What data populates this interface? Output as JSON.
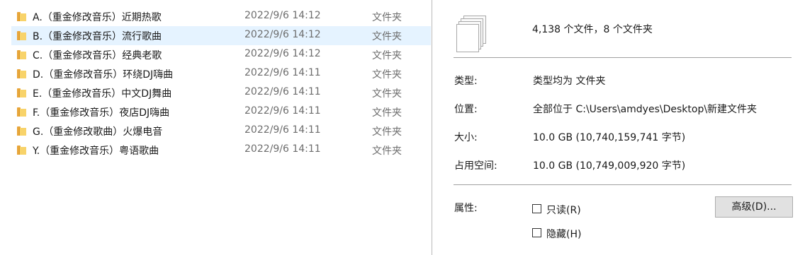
{
  "file_list": {
    "rows": [
      {
        "name": "A.（重金修改音乐）近期热歌",
        "date": "2022/9/6 14:12",
        "type": "文件夹"
      },
      {
        "name": "B.（重金修改音乐）流行歌曲",
        "date": "2022/9/6 14:12",
        "type": "文件夹"
      },
      {
        "name": "C.（重金修改音乐）经典老歌",
        "date": "2022/9/6 14:12",
        "type": "文件夹"
      },
      {
        "name": "D.（重金修改音乐）环绕DJ嗨曲",
        "date": "2022/9/6 14:11",
        "type": "文件夹"
      },
      {
        "name": "E.（重金修改音乐）中文DJ舞曲",
        "date": "2022/9/6 14:11",
        "type": "文件夹"
      },
      {
        "name": "F.（重金修改音乐）夜店DJ嗨曲",
        "date": "2022/9/6 14:11",
        "type": "文件夹"
      },
      {
        "name": "G.（重金修改歌曲）火爆电音",
        "date": "2022/9/6 14:11",
        "type": "文件夹"
      },
      {
        "name": "Y.（重金修改音乐）粤语歌曲",
        "date": "2022/9/6 14:11",
        "type": "文件夹"
      }
    ],
    "selected_row_index": 1
  },
  "properties": {
    "summary": "4,138 个文件，8 个文件夹",
    "type_label": "类型:",
    "type_value": "类型均为 文件夹",
    "location_label": "位置:",
    "location_value": "全部位于 C:\\Users\\amdyes\\Desktop\\新建文件夹",
    "size_label": "大小:",
    "size_value": "10.0 GB (10,740,159,741 字节)",
    "disk_size_label": "占用空间:",
    "disk_size_value": "10.0 GB (10,749,009,920 字节)",
    "attributes_label": "属性:",
    "readonly_label": "只读(R)",
    "readonly_checked": false,
    "hidden_label": "隐藏(H)",
    "hidden_checked": false,
    "advanced_button": "高级(D)..."
  },
  "colors": {
    "selection": "#e5f3ff",
    "folder": "#f8d36a",
    "secondary_text": "#6d6d6d"
  },
  "icons": {
    "folder": "folder-icon",
    "multiple_files": "multiple-files-icon"
  }
}
